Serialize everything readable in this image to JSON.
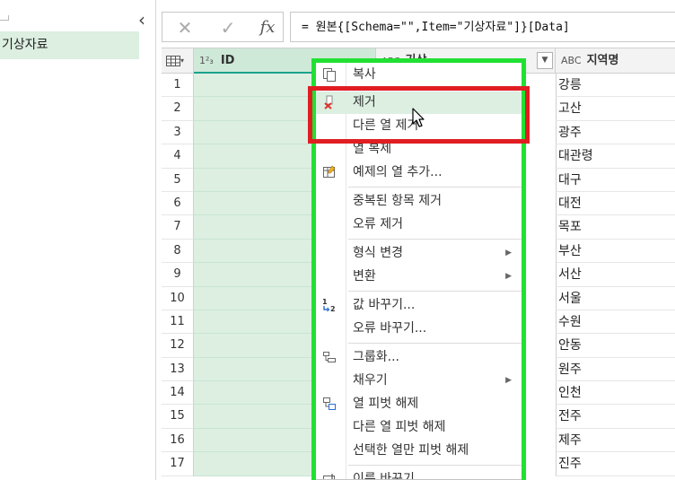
{
  "query_pane": {
    "collapse_glyph": "‹",
    "selected_query": "기상자료"
  },
  "formula_bar": {
    "cancel_glyph": "✕",
    "confirm_glyph": "✓",
    "fx_label": "fx",
    "formula": "= 원본{[Schema=\"\",Item=\"기상자료\"]}[Data]"
  },
  "grid": {
    "table_menu_icon": "table-icon",
    "columns": [
      {
        "type": "1²₃",
        "name": "ID"
      },
      {
        "type": "ABC",
        "name": "기상"
      },
      {
        "type": "ABC",
        "name": "지역명"
      }
    ],
    "rows": [
      {
        "num": "1",
        "region": "강릉"
      },
      {
        "num": "2",
        "region": "고산"
      },
      {
        "num": "3",
        "region": "광주"
      },
      {
        "num": "4",
        "region": "대관령"
      },
      {
        "num": "5",
        "region": "대구"
      },
      {
        "num": "6",
        "region": "대전"
      },
      {
        "num": "7",
        "region": "목포"
      },
      {
        "num": "8",
        "region": "부산"
      },
      {
        "num": "9",
        "region": "서산"
      },
      {
        "num": "10",
        "region": "서울"
      },
      {
        "num": "11",
        "region": "수원"
      },
      {
        "num": "12",
        "region": "안동"
      },
      {
        "num": "13",
        "region": "원주"
      },
      {
        "num": "14",
        "region": "인천"
      },
      {
        "num": "15",
        "region": "전주"
      },
      {
        "num": "16",
        "region": "제주"
      },
      {
        "num": "17",
        "region": "진주"
      }
    ]
  },
  "context_menu": {
    "copy": "복사",
    "remove": "제거",
    "remove_other": "다른 열 제거",
    "duplicate": "열 복제",
    "add_from_examples": "예제의 열 추가...",
    "remove_duplicates": "중복된 항목 제거",
    "remove_errors": "오류 제거",
    "change_type": "형식 변경",
    "transform": "변환",
    "replace_values": "값 바꾸기...",
    "replace_errors": "오류 바꾸기...",
    "group_by": "그룹화...",
    "fill": "채우기",
    "unpivot": "열 피벗 해제",
    "unpivot_other": "다른 열 피벗 해제",
    "unpivot_selected": "선택한 열만 피벗 해제",
    "rename": "이름 바꾸기..."
  },
  "colors": {
    "selection_green": "#dcefe1",
    "highlight_green": "#22e033",
    "highlight_red": "#e01e22",
    "accent_teal": "#19a28c"
  }
}
